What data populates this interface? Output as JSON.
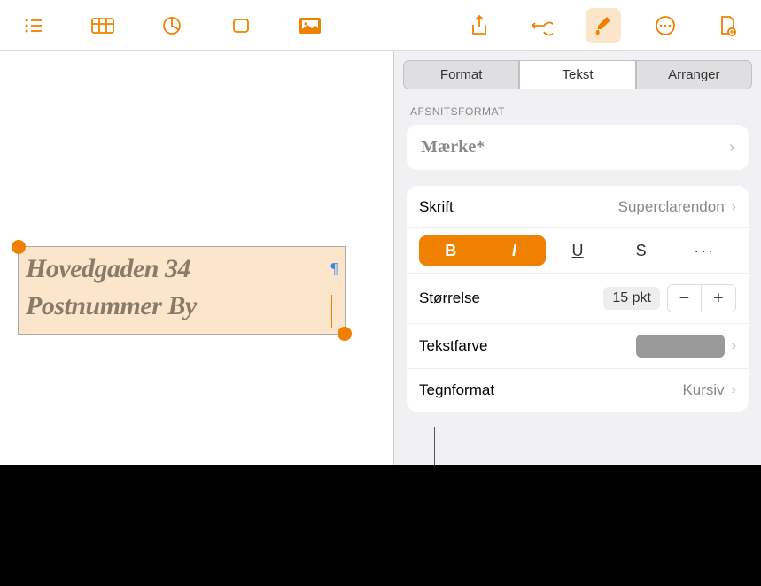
{
  "toolbar": {
    "icons": [
      "list",
      "table",
      "chart",
      "shape",
      "image",
      "share",
      "undo",
      "brush",
      "more",
      "document"
    ]
  },
  "canvas": {
    "line1": "Hovedgaden 34",
    "line2": "Postnummer By"
  },
  "inspector": {
    "tabs": {
      "format": "Format",
      "text": "Tekst",
      "arrange": "Arranger"
    },
    "section_para": "AFSNITSFORMAT",
    "style_name": "Mærke*",
    "font": {
      "label": "Skrift",
      "value": "Superclarendon"
    },
    "styles": {
      "bold": "B",
      "italic": "I",
      "underline": "U",
      "strike": "S",
      "more": "···"
    },
    "size": {
      "label": "Størrelse",
      "value": "15 pkt"
    },
    "color": {
      "label": "Tekstfarve",
      "value": "#999999"
    },
    "charformat": {
      "label": "Tegnformat",
      "value": "Kursiv"
    }
  }
}
